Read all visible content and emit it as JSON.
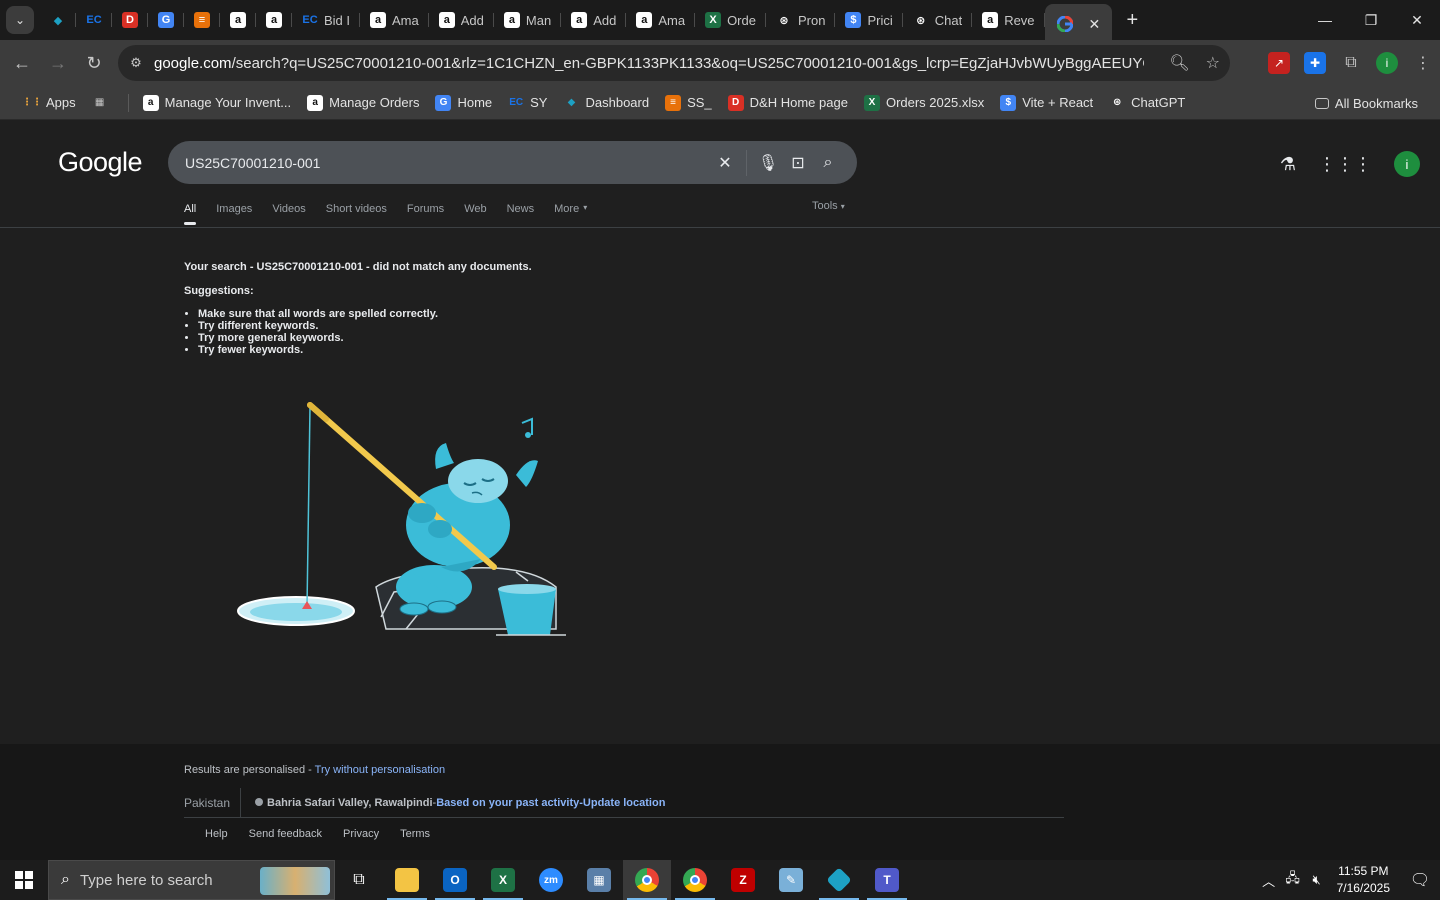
{
  "browser": {
    "tabs": [
      {
        "label": "",
        "icon": "dashboard-icon",
        "color": "#1da1c4"
      },
      {
        "label": "",
        "icon": "ec-icon",
        "color": "#1a73e8"
      },
      {
        "label": "",
        "icon": "dh-icon",
        "color": "#d93025"
      },
      {
        "label": "",
        "icon": "g-icon",
        "color": "#4285f4"
      },
      {
        "label": "",
        "icon": "stack-icon",
        "color": "#e8710a"
      },
      {
        "label": "",
        "icon": "amazon-icon",
        "color": "#ffffff"
      },
      {
        "label": "",
        "icon": "amazon-icon",
        "color": "#ffffff"
      },
      {
        "label": "Bid I",
        "icon": "ec-icon",
        "color": "#1a73e8"
      },
      {
        "label": "Ama",
        "icon": "amazon-icon",
        "color": "#ffffff"
      },
      {
        "label": "Add",
        "icon": "amazon-icon",
        "color": "#ffffff"
      },
      {
        "label": "Man",
        "icon": "amazon-icon",
        "color": "#ffffff"
      },
      {
        "label": "Add",
        "icon": "amazon-icon",
        "color": "#ffffff"
      },
      {
        "label": "Ama",
        "icon": "amazon-icon",
        "color": "#ffffff"
      },
      {
        "label": "Orde",
        "icon": "excel-icon",
        "color": "#1e7145"
      },
      {
        "label": "Pron",
        "icon": "openai-icon",
        "color": "#ffffff"
      },
      {
        "label": "Prici",
        "icon": "dollar-icon",
        "color": "#4285f4"
      },
      {
        "label": "Chat",
        "icon": "openai-icon",
        "color": "#ffffff"
      },
      {
        "label": "Reve",
        "icon": "amazon-icon",
        "color": "#ffffff"
      }
    ],
    "active_tab_icon": "google-icon",
    "url_host": "google.com",
    "url_path": "/search?q=US25C70001210-001&rlz=1C1CHZN_en-GBPK1133PK1133&oq=US25C70001210-001&gs_lcrp=EgZjaHJvbWUyBggAEEUYOTIKCAEQABi...",
    "bookmarks": [
      {
        "label": "Apps",
        "icon": "apps-grid-icon"
      },
      {
        "label": "",
        "icon": "tab-groups-icon"
      },
      {
        "label": "Manage Your Invent...",
        "icon": "amazon-icon"
      },
      {
        "label": "Manage Orders",
        "icon": "amazon-icon"
      },
      {
        "label": "Home",
        "icon": "g-icon"
      },
      {
        "label": "SY",
        "icon": "ec-icon"
      },
      {
        "label": "Dashboard",
        "icon": "dashboard-icon"
      },
      {
        "label": "SS_",
        "icon": "stack-icon"
      },
      {
        "label": "D&H Home page",
        "icon": "dh-icon"
      },
      {
        "label": "Orders 2025.xlsx",
        "icon": "excel-icon"
      },
      {
        "label": "Vite + React",
        "icon": "dollar-icon"
      },
      {
        "label": "ChatGPT",
        "icon": "openai-icon"
      }
    ],
    "all_bookmarks": "All Bookmarks",
    "profile_initial": "i"
  },
  "google": {
    "logo": "Google",
    "query": "US25C70001210-001",
    "nav": [
      "All",
      "Images",
      "Videos",
      "Short videos",
      "Forums",
      "Web",
      "News",
      "More"
    ],
    "tools": "Tools",
    "no_results_prefix": "Your search - ",
    "no_results_query": "US25C70001210-001",
    "no_results_suffix": " - did not match any documents.",
    "suggestions_title": "Suggestions:",
    "suggestions": [
      "Make sure that all words are spelled correctly.",
      "Try different keywords.",
      "Try more general keywords.",
      "Try fewer keywords."
    ],
    "footer": {
      "personalised": "Results are personalised - ",
      "personalised_link": "Try without personalisation",
      "country": "Pakistan",
      "location": "Bahria Safari Valley, Rawalpindi",
      "location_sep": " - ",
      "based_on": "Based on your past activity",
      "dash": " - ",
      "update": "Update location",
      "links": [
        "Help",
        "Send feedback",
        "Privacy",
        "Terms"
      ]
    },
    "avatar_initial": "i"
  },
  "taskbar": {
    "search_placeholder": "Type here to search",
    "time": "11:55 PM",
    "date": "7/16/2025"
  }
}
